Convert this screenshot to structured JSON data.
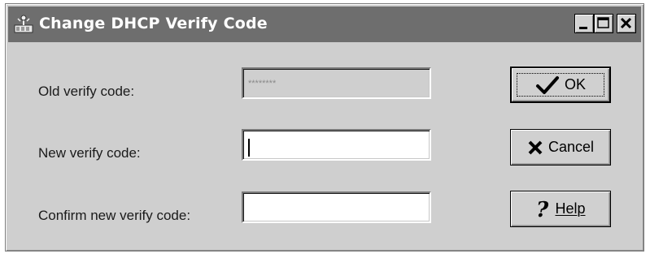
{
  "window": {
    "title": "Change DHCP Verify Code",
    "icons": {
      "app": "network-app-icon",
      "minimize": "minimize-icon",
      "maximize": "maximize-icon",
      "close": "close-icon"
    }
  },
  "form": {
    "old_label": "Old verify code:",
    "old_value": "********",
    "new_label": "New verify code:",
    "new_value": "",
    "confirm_label": "Confirm new verify code:",
    "confirm_value": ""
  },
  "buttons": {
    "ok_label": "OK",
    "cancel_label": "Cancel",
    "help_label": "Help"
  }
}
